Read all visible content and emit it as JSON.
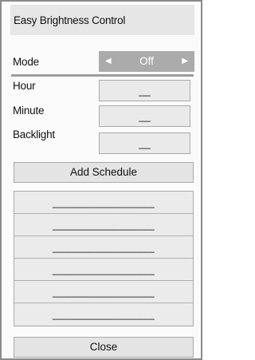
{
  "dialog": {
    "title": "Easy Brightness Control"
  },
  "mode": {
    "label": "Mode",
    "value": "Off",
    "arrow_left": "◀",
    "arrow_right": "▶"
  },
  "fields": {
    "hour": {
      "label": "Hour",
      "value": "__"
    },
    "minute": {
      "label": "Minute",
      "value": "__"
    },
    "backlight": {
      "label": "Backlight",
      "value": "__"
    }
  },
  "buttons": {
    "add_schedule": "Add Schedule",
    "close": "Close"
  },
  "schedule_slots": [
    "_________________",
    "_________________",
    "_________________",
    "_________________",
    "_________________",
    "_________________"
  ]
}
